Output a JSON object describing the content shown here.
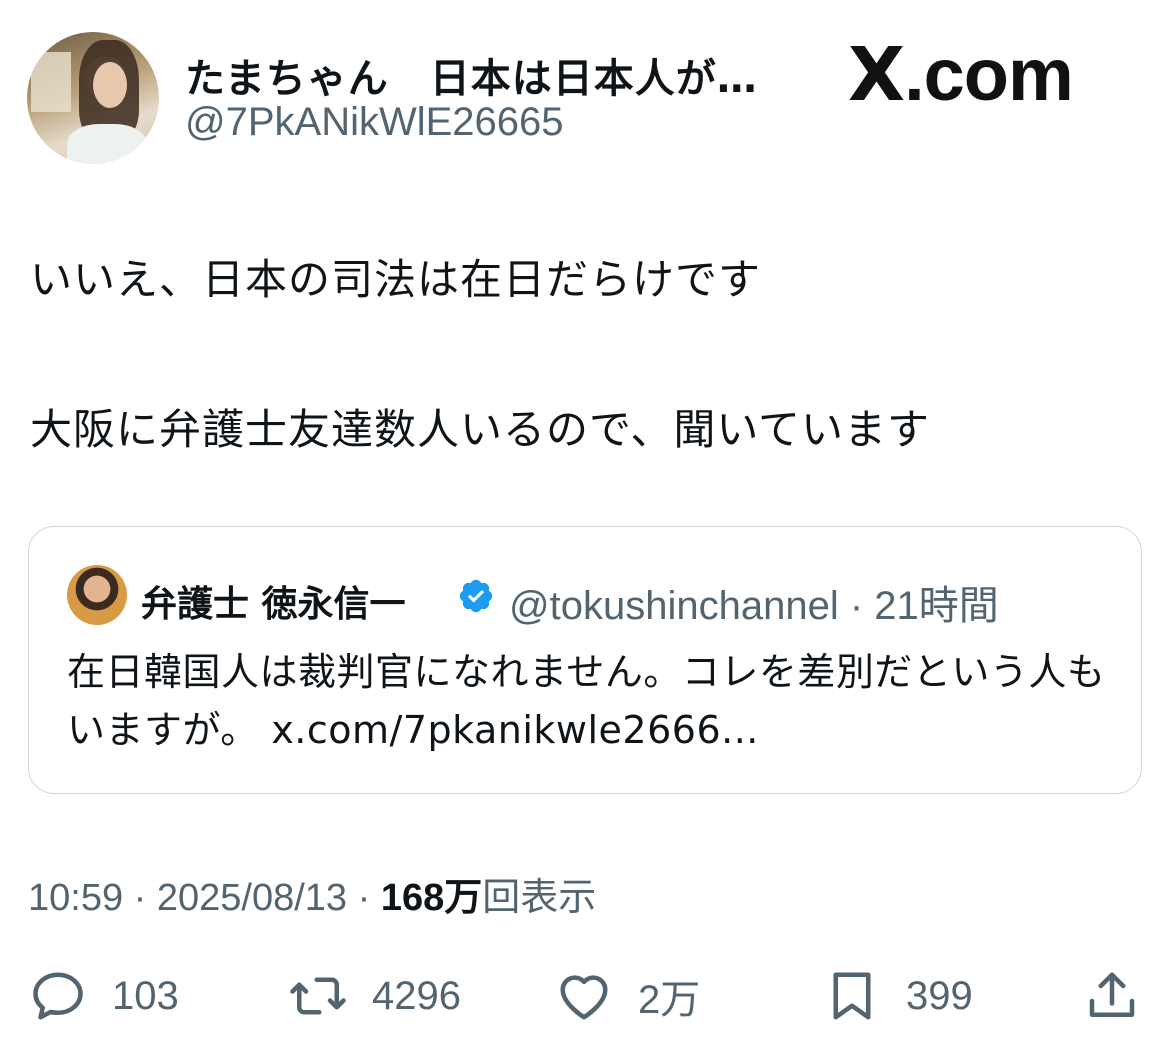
{
  "author": {
    "display_name": "たまちゃん　日本は日本人が…",
    "handle": "@7PkANikWlE26665",
    "avatar_icon": "user-avatar-photo"
  },
  "brand": {
    "x": "X",
    "rest": ".com"
  },
  "tweet": {
    "line1": "いいえ、日本の司法は在日だらけです",
    "line2": "大阪に弁護士友達数人いるので、聞いています"
  },
  "quoted": {
    "name": "弁護士 徳永信一",
    "verified_icon": "verified-badge-icon",
    "handle_time": "@tokushinchannel · 21時間",
    "text": "在日韓国人は裁判官になれません。コレを差別だという人もいますが。 x.com/7pkanikwle2666..."
  },
  "meta": {
    "time": "10:59",
    "date": "2025/08/13",
    "views_number": "168万",
    "views_label": "回表示"
  },
  "actions": {
    "replies": "103",
    "retweets": "4296",
    "likes": "2万",
    "bookmarks": "399"
  },
  "colors": {
    "text": "#0f1419",
    "secondary": "#536471",
    "verified": "#1d9bf0",
    "border": "#cfd9de"
  }
}
